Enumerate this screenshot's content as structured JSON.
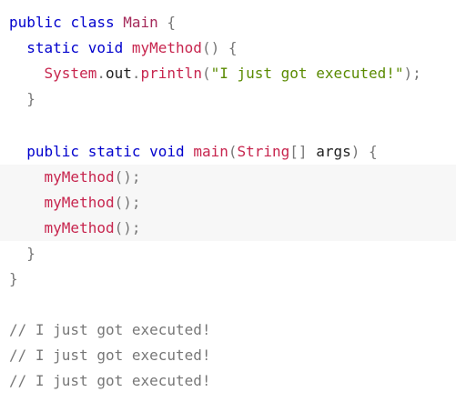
{
  "code": {
    "line1": {
      "public": "public",
      "class": "class",
      "name": "Main",
      "brace": "{"
    },
    "line2": {
      "static": "static",
      "void": "void",
      "name": "myMethod",
      "parens": "()",
      "brace": "{"
    },
    "line3": {
      "system": "System",
      "dot1": ".",
      "out": "out",
      "dot2": ".",
      "println": "println",
      "open": "(",
      "string": "\"I just got executed!\"",
      "close": ");"
    },
    "line4": {
      "brace": "}"
    },
    "line6": {
      "public": "public",
      "static": "static",
      "void": "void",
      "name": "main",
      "open": "(",
      "type": "String",
      "brackets": "[]",
      "param": "args",
      "close": ")",
      "brace": "{"
    },
    "calls": [
      {
        "name": "myMethod",
        "tail": "();"
      },
      {
        "name": "myMethod",
        "tail": "();"
      },
      {
        "name": "myMethod",
        "tail": "();"
      }
    ],
    "line10": {
      "brace": "}"
    },
    "line11": {
      "brace": "}"
    },
    "comments": [
      "// I just got executed!",
      "// I just got executed!",
      "// I just got executed!"
    ]
  },
  "colors": {
    "keyword": "#0000cd",
    "class_name": "#a52a5a",
    "method": "#c7254e",
    "string": "#5a8a00",
    "punctuation": "#777777",
    "comment": "#777777",
    "highlight_background": "#f7f7f7"
  }
}
